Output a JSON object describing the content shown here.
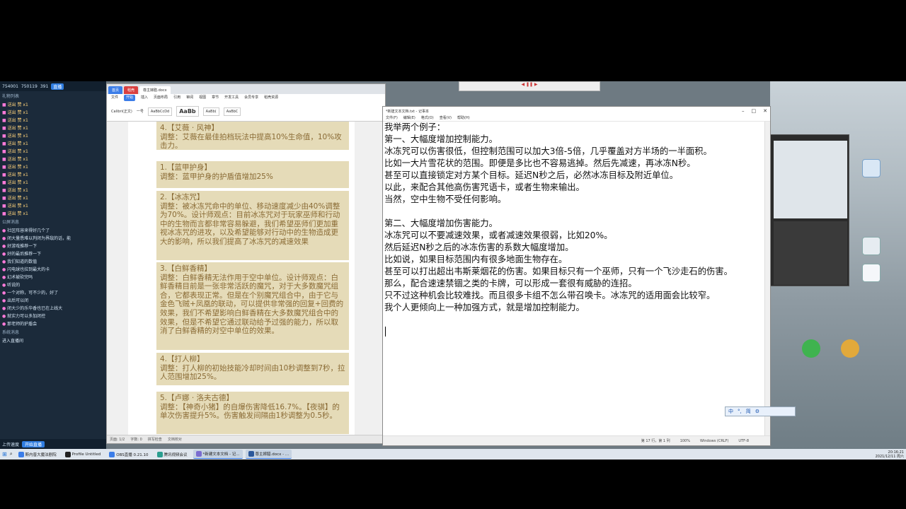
{
  "chat": {
    "header_stats": [
      "754001",
      "750119",
      "391"
    ],
    "header_badge": "直播",
    "section_title": "礼物列表",
    "gift_messages": [
      "送出 赞 x1",
      "送出 赞 x1",
      "送出 赞 x1",
      "送出 赞 x1",
      "送出 赞 x1",
      "送出 赞 x1",
      "送出 赞 x1",
      "送出 赞 x1",
      "送出 赞 x1",
      "送出 赞 x1",
      "送出 赞 x1",
      "送出 赞 x1",
      "送出 赞 x1",
      "送出 赞 x1",
      "送出 赞 x1"
    ],
    "chat_title": "公屏消息",
    "chat_messages": [
      "社区阵容来得好几个了",
      "闭大量悉难以判闭为界敌的话，能",
      "好游戏推荐一下",
      "好的最后推荐一下",
      "我们知道的数值",
      "闪电球也拉到最大的卡",
      "幻术被砍完吗",
      "听说的",
      "一个对称，可不少的，好了",
      "出后可以闭",
      "闭大少的乐华香也已在上线大",
      "就实力可以多加闭控",
      "那老师的护盾会"
    ],
    "system_title": "系统消息",
    "system_message": "进入直播间",
    "footer_text": "上传速度",
    "footer_button": "开始直播"
  },
  "wps": {
    "tabs": [
      "首页",
      "稻壳",
      "尊主嫁腊.docx"
    ],
    "menu": [
      "文件",
      "开始",
      "插入",
      "页面布局",
      "引用",
      "审阅",
      "视图",
      "章节",
      "开发工具",
      "会员专享",
      "稻壳资源"
    ],
    "menu_active": "开始",
    "ribbon_font": "Calibri(正文)",
    "ribbon_size": "一号",
    "styles": [
      "AaBbCcDd",
      "AaBb",
      "AaBb(",
      "AaBbC"
    ],
    "blocks": [
      {
        "title": "4.【艾薇 · 风神】",
        "body": "调整：艾薇在最佳拍档玩法中提高10%生命值，10%攻击力。"
      },
      {
        "title": "1.【蓝甲护身】",
        "body": "调整：蓝甲护身的护盾值增加25%"
      },
      {
        "title": "2.【冰冻咒】",
        "body": "调整：被冰冻咒命中的单位、移动速度减少由40%调整为70%。设计师观点：目前冰冻咒对于玩家巫师和行动中的生物而言都非常容易躲避，我们希望巫师们更加重视冰冻咒的进攻，以及希望能够对行动中的生物造成更大的影响，所以我们提高了冰冻咒的减速效果"
      },
      {
        "title": "3.【白鲜香精】",
        "body": "调整：白鲜香精无法作用于空中单位。设计师观点：白鲜香精目前是一张非常活跃的魔咒，对于大多数魔咒组合，它都表现正常。但是在个别魔咒组合中，由于它与金色飞贼+凤凰的联动，可以提供非常强的回复+回费的效果，我们不希望影响白鲜香精在大多数魔咒组合中的效果，但是不希望它通过联动给予过强的能力，所以取消了白鲜香精的对空中单位的效果。"
      },
      {
        "title": "4.【打人柳】",
        "body": "调整：打人柳的初始技能冷却时间由10秒调整到7秒，拉人范围增加25%。"
      },
      {
        "title": "5.【卢娜 · 洛夫古德】",
        "body": "调整：【神奇小猪】的自爆伤害降低16.7%。【夜骐】的单次伤害提升5%。伤害触发间隔由1秒调整为0.5秒。"
      }
    ],
    "status_left": "页面: 1/2",
    "status_words": "字数: 0",
    "status_mid": "拼写检查",
    "status_right": "文档校对"
  },
  "notepad": {
    "title": "*新建文本文档.txt - 记事本",
    "menu": [
      "文件(F)",
      "编辑(E)",
      "格式(O)",
      "查看(V)",
      "帮助(H)"
    ],
    "lines": [
      "我举两个例子：",
      "第一、大幅度增加控制能力。",
      "冰冻咒可以伤害很低，但控制范围可以加大3倍-5倍，几乎覆盖对方半场的一半面积。",
      "比如一大片雪花状的范围。即便是多比也不容易逃掉。然后先减速，再冰冻N秒。",
      "甚至可以直接锁定对方某个目标。延迟N秒之后，必然冰冻目标及附近单位。",
      "以此，来配合其他高伤害咒语卡，或者生物来输出。",
      "当然，空中生物不受任何影响。",
      "",
      "第二、大幅度增加伤害能力。",
      "冰冻咒可以不要减速效果，或者减速效果很弱，比如20%。",
      "然后延迟N秒之后的冰冻伤害的系数大幅度增加。",
      "比如说，如果目标范围内有很多地面生物存在。",
      "甚至可以打出超出韦斯莱烟花的伤害。如果目标只有一个巫师，只有一个飞沙走石的伤害。",
      "那么，配合速速禁锢之类的卡牌，可以形成一套很有威胁的连招。",
      "只不过这种机会比较难找。而且很多卡组不怎么带召唤卡。冰冻咒的适用面会比较窄。",
      "我个人更倾向上一种加强方式，就是增加控制能力。"
    ],
    "status": [
      "第 17 行，第 1 列",
      "100%",
      "Windows (CRLF)",
      "UTF-8"
    ]
  },
  "ime": [
    "中",
    "°,",
    "简",
    "⚙"
  ],
  "taskbar": {
    "items": [
      "斯内普大魔法剧院",
      "Profile Untitled",
      "OBS直播 0.21.10",
      "腾讯视频会议",
      "*新建文本文档 - 记...",
      "尊主嫁腊.docx - ..."
    ],
    "time": "20:16:21",
    "date": "2021/12/11 周六"
  }
}
